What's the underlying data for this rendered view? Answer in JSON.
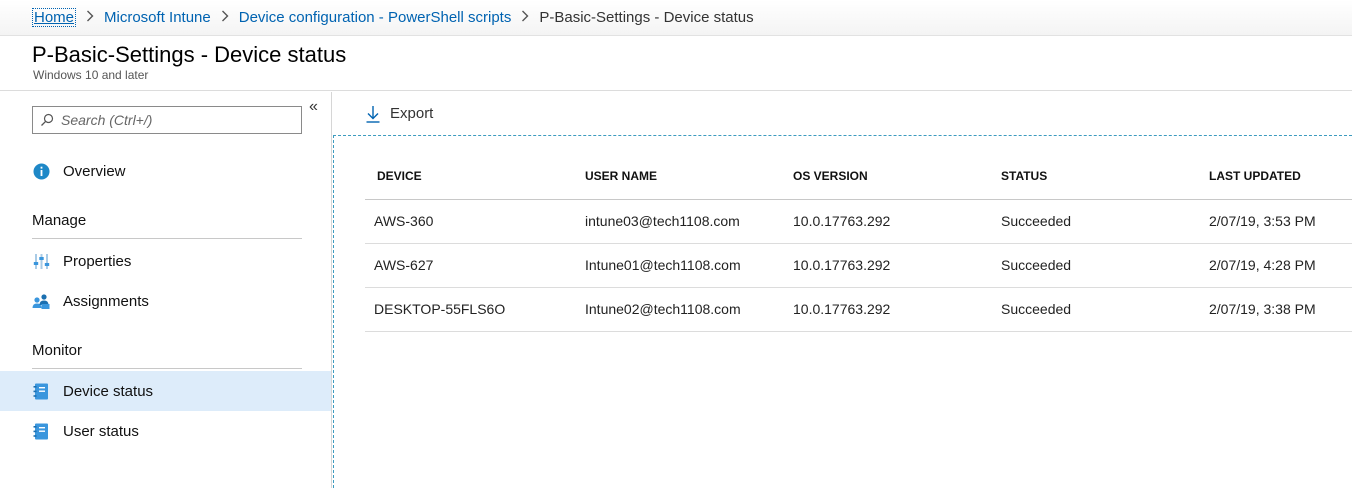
{
  "breadcrumb": {
    "items": [
      "Home",
      "Microsoft Intune",
      "Device configuration - PowerShell scripts"
    ],
    "current": "P-Basic-Settings - Device status",
    "separator": ">"
  },
  "header": {
    "title": "P-Basic-Settings - Device status",
    "subtitle": "Windows 10 and later"
  },
  "sidebar": {
    "search_placeholder": "Search (Ctrl+/)",
    "collapse_glyph": "«",
    "overview": "Overview",
    "manage_label": "Manage",
    "manage_items": [
      "Properties",
      "Assignments"
    ],
    "monitor_label": "Monitor",
    "monitor_items": [
      "Device status",
      "User status"
    ],
    "selected": "Device status"
  },
  "toolbar": {
    "export_label": "Export"
  },
  "table": {
    "columns": [
      "DEVICE",
      "USER NAME",
      "OS VERSION",
      "STATUS",
      "LAST UPDATED"
    ],
    "rows": [
      [
        "AWS-360",
        "intune03@tech1108.com",
        "10.0.17763.292",
        "Succeeded",
        "2/07/19, 3:53 PM"
      ],
      [
        "AWS-627",
        "Intune01@tech1108.com",
        "10.0.17763.292",
        "Succeeded",
        "2/07/19, 4:28 PM"
      ],
      [
        "DESKTOP-55FLS6O",
        "Intune02@tech1108.com",
        "10.0.17763.292",
        "Succeeded",
        "2/07/19, 3:38 PM"
      ]
    ]
  },
  "colors": {
    "link": "#0063b1",
    "selected_bg": "#ddecfa",
    "icon_blue": "#3a96dd",
    "info_blue": "#1e88c7",
    "dash_border": "#3d9bbf"
  }
}
